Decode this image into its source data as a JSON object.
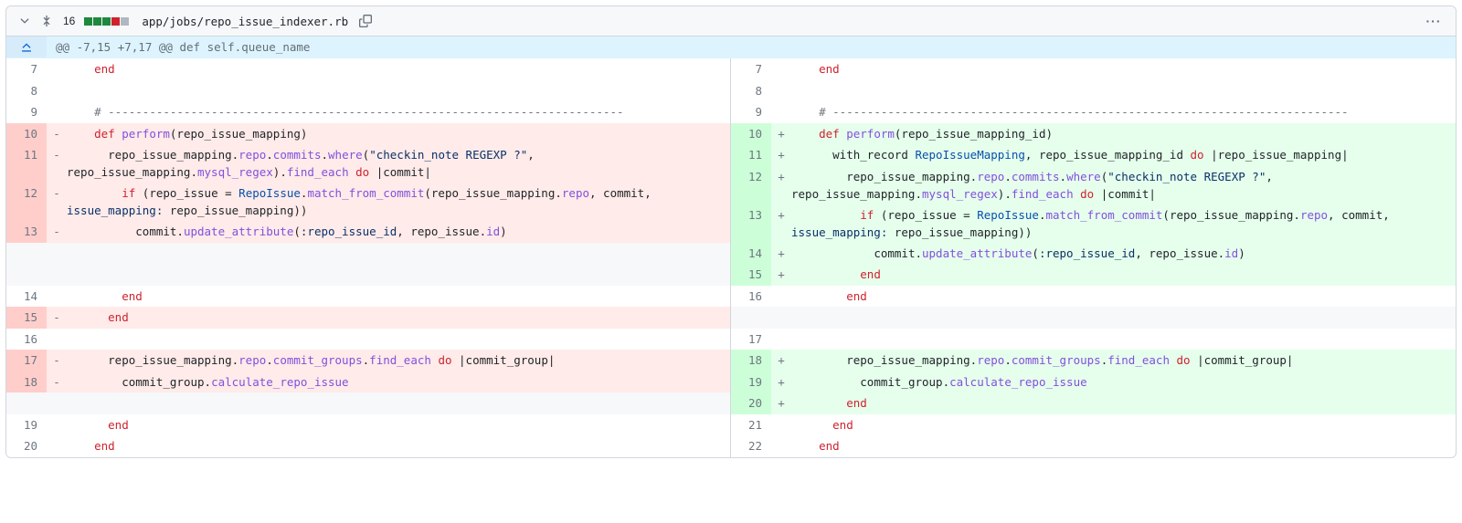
{
  "header": {
    "lines_changed": "16",
    "diffstat": {
      "added": 3,
      "removed": 1,
      "neutral": 1
    },
    "filepath": "app/jobs/repo_issue_indexer.rb"
  },
  "hunk": {
    "text": "@@ -7,15 +7,17 @@ def self.queue_name"
  },
  "left": [
    {
      "n": "7",
      "t": "ctx",
      "code": "    <span class=\"k\">end</span>"
    },
    {
      "n": "8",
      "t": "ctx",
      "code": ""
    },
    {
      "n": "9",
      "t": "ctx",
      "code": "    <span class=\"cm\"># ---------------------------------------------------------------------------</span>"
    },
    {
      "n": "10",
      "t": "del",
      "code": "    <span class=\"k\">def</span> <span class=\"fn\">perform</span>(repo_issue_mapping)"
    },
    {
      "n": "11",
      "t": "del",
      "code": "      repo_issue_mapping.<span class=\"fn\">repo</span>.<span class=\"fn\">commits</span>.<span class=\"fn\">where</span>(<span class=\"str\">\"checkin_note REGEXP ?\"</span>, repo_issue_mapping.<span class=\"fn\">mysql_regex</span>).<span class=\"fn\">find_each</span> <span class=\"k\">do</span> |commit|"
    },
    {
      "n": "12",
      "t": "del",
      "code": "        <span class=\"k\">if</span> (repo_issue = <span class=\"cn\">RepoIssue</span>.<span class=\"fn\">match_from_commit</span>(repo_issue_mapping.<span class=\"fn\">repo</span>, commit, <span class=\"sym\">issue_mapping:</span> repo_issue_mapping))"
    },
    {
      "n": "13",
      "t": "del",
      "code": "          commit.<span class=\"fn\">update_attribute</span>(<span class=\"sym\">:repo_issue_id</span>, repo_issue.<span class=\"fn\">id</span>)"
    },
    {
      "n": "",
      "t": "empty",
      "code": ""
    },
    {
      "n": "",
      "t": "empty",
      "code": ""
    },
    {
      "n": "14",
      "t": "ctx",
      "code": "        <span class=\"k\">end</span>"
    },
    {
      "n": "15",
      "t": "del",
      "code": "      <span class=\"k\">end</span>"
    },
    {
      "n": "16",
      "t": "ctx",
      "code": ""
    },
    {
      "n": "17",
      "t": "del",
      "code": "      repo_issue_mapping.<span class=\"fn\">repo</span>.<span class=\"fn\">commit_groups</span>.<span class=\"fn\">find_each</span> <span class=\"k\">do</span> |commit_group|"
    },
    {
      "n": "18",
      "t": "del",
      "code": "        commit_group.<span class=\"fn\">calculate_repo_issue</span>"
    },
    {
      "n": "",
      "t": "empty",
      "code": ""
    },
    {
      "n": "19",
      "t": "ctx",
      "code": "      <span class=\"k\">end</span>"
    },
    {
      "n": "20",
      "t": "ctx",
      "code": "    <span class=\"k\">end</span>"
    }
  ],
  "right": [
    {
      "n": "7",
      "t": "ctx",
      "code": "    <span class=\"k\">end</span>"
    },
    {
      "n": "8",
      "t": "ctx",
      "code": ""
    },
    {
      "n": "9",
      "t": "ctx",
      "code": "    <span class=\"cm\"># ---------------------------------------------------------------------------</span>"
    },
    {
      "n": "10",
      "t": "add",
      "code": "    <span class=\"k\">def</span> <span class=\"fn\">perform</span>(repo_issue_mapping_id)"
    },
    {
      "n": "11",
      "t": "add",
      "code": "      with_record <span class=\"cn\">RepoIssueMapping</span>, repo_issue_mapping_id <span class=\"k\">do</span> |repo_issue_mapping|"
    },
    {
      "n": "12",
      "t": "add",
      "code": "        repo_issue_mapping.<span class=\"fn\">repo</span>.<span class=\"fn\">commits</span>.<span class=\"fn\">where</span>(<span class=\"str\">\"checkin_note REGEXP ?\"</span>, repo_issue_mapping.<span class=\"fn\">mysql_regex</span>).<span class=\"fn\">find_each</span> <span class=\"k\">do</span> |commit|"
    },
    {
      "n": "13",
      "t": "add",
      "code": "          <span class=\"k\">if</span> (repo_issue = <span class=\"cn\">RepoIssue</span>.<span class=\"fn\">match_from_commit</span>(repo_issue_mapping.<span class=\"fn\">repo</span>, commit, <span class=\"sym\">issue_mapping:</span> repo_issue_mapping))"
    },
    {
      "n": "14",
      "t": "add",
      "code": "            commit.<span class=\"fn\">update_attribute</span>(<span class=\"sym\">:repo_issue_id</span>, repo_issue.<span class=\"fn\">id</span>)"
    },
    {
      "n": "15",
      "t": "add",
      "code": "          <span class=\"k\">end</span>"
    },
    {
      "n": "16",
      "t": "ctx",
      "code": "        <span class=\"k\">end</span>"
    },
    {
      "n": "",
      "t": "empty",
      "code": ""
    },
    {
      "n": "17",
      "t": "ctx",
      "code": ""
    },
    {
      "n": "18",
      "t": "add",
      "code": "        repo_issue_mapping.<span class=\"fn\">repo</span>.<span class=\"fn\">commit_groups</span>.<span class=\"fn\">find_each</span> <span class=\"k\">do</span> |commit_group|"
    },
    {
      "n": "19",
      "t": "add",
      "code": "          commit_group.<span class=\"fn\">calculate_repo_issue</span>"
    },
    {
      "n": "20",
      "t": "add",
      "code": "        <span class=\"k\">end</span>"
    },
    {
      "n": "21",
      "t": "ctx",
      "code": "      <span class=\"k\">end</span>"
    },
    {
      "n": "22",
      "t": "ctx",
      "code": "    <span class=\"k\">end</span>"
    }
  ]
}
